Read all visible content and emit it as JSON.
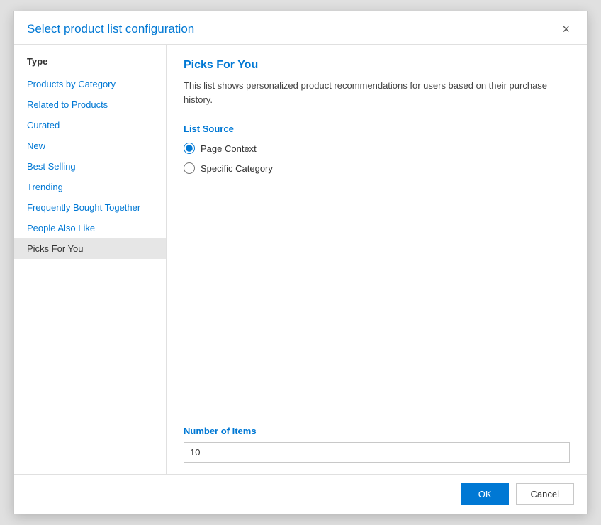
{
  "dialog": {
    "title": "Select product list configuration",
    "close_label": "×"
  },
  "sidebar": {
    "header": "Type",
    "items": [
      {
        "id": "products-by-category",
        "label": "Products by Category",
        "active": false
      },
      {
        "id": "related-to-products",
        "label": "Related to Products",
        "active": false
      },
      {
        "id": "curated",
        "label": "Curated",
        "active": false
      },
      {
        "id": "new",
        "label": "New",
        "active": false
      },
      {
        "id": "best-selling",
        "label": "Best Selling",
        "active": false
      },
      {
        "id": "trending",
        "label": "Trending",
        "active": false
      },
      {
        "id": "frequently-bought-together",
        "label": "Frequently Bought Together",
        "active": false
      },
      {
        "id": "people-also-like",
        "label": "People Also Like",
        "active": false
      },
      {
        "id": "picks-for-you",
        "label": "Picks For You",
        "active": true
      }
    ]
  },
  "main": {
    "title": "Picks For You",
    "description": "This list shows personalized product recommendations for users based on their purchase history.",
    "list_source_label": "List Source",
    "radio_options": [
      {
        "id": "page-context",
        "label": "Page Context",
        "checked": true
      },
      {
        "id": "specific-category",
        "label": "Specific Category",
        "checked": false
      }
    ]
  },
  "footer": {
    "number_of_items_label": "Number of Items",
    "number_of_items_value": "10",
    "number_of_items_placeholder": ""
  },
  "buttons": {
    "ok_label": "OK",
    "cancel_label": "Cancel"
  }
}
